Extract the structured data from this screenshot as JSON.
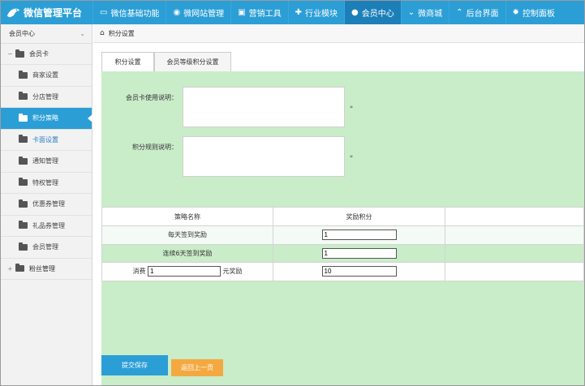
{
  "app": {
    "title": "微信管理平台"
  },
  "nav": [
    {
      "label": "微信基础功能",
      "icon": "monitor-icon"
    },
    {
      "label": "微网站管理",
      "icon": "globe-icon"
    },
    {
      "label": "营销工具",
      "icon": "bag-icon"
    },
    {
      "label": "行业模块",
      "icon": "puzzle-icon"
    },
    {
      "label": "会员中心",
      "icon": "user-icon",
      "active": true
    },
    {
      "label": "微商城",
      "icon": "chevron-down-icon"
    },
    {
      "label": "后台界面",
      "icon": "chevron-up-icon"
    },
    {
      "label": "控制面板",
      "icon": "gear-icon"
    }
  ],
  "sidebar": {
    "header": "会员中心",
    "group1": "会员卡",
    "items": [
      {
        "label": "商家设置"
      },
      {
        "label": "分店管理"
      },
      {
        "label": "积分策略",
        "active": true
      },
      {
        "label": "卡面设置",
        "highlight": true
      },
      {
        "label": "通知管理"
      },
      {
        "label": "特权管理"
      },
      {
        "label": "优惠券管理"
      },
      {
        "label": "礼品券管理"
      },
      {
        "label": "会员管理"
      }
    ],
    "group2": "粉丝管理"
  },
  "breadcrumb": {
    "label": "积分设置"
  },
  "tabs": {
    "active": "积分设置",
    "other": "会员等级积分设置"
  },
  "form": {
    "card_usage_label": "会员卡使用说明：",
    "card_usage_value": "",
    "points_rule_label": "积分规则说明：",
    "points_rule_value": "",
    "marker": "*"
  },
  "table": {
    "headers": [
      "策略名称",
      "奖励积分"
    ],
    "rows": [
      {
        "name": "每天签到奖励",
        "points": "1"
      },
      {
        "name": "连续6天签到奖励",
        "points": "1"
      },
      {
        "prefix": "消费",
        "amount": "1",
        "suffix": "元奖励",
        "points": "10"
      }
    ]
  },
  "buttons": {
    "save": "提交保存",
    "back": "返回上一页"
  },
  "colors": {
    "primary": "#2b9ed6",
    "panel_green": "#c9ecc9",
    "back_orange": "#f4a940"
  }
}
